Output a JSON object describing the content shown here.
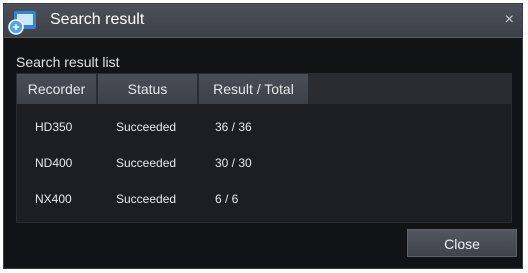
{
  "dialog": {
    "title": "Search result",
    "close_glyph": "×",
    "icon": "app-icon"
  },
  "section": {
    "label": "Search result list"
  },
  "table": {
    "columns": [
      "Recorder",
      "Status",
      "Result / Total"
    ],
    "rows": [
      [
        "HD350",
        "Succeeded",
        "36 / 36"
      ],
      [
        "ND400",
        "Succeeded",
        "30 / 30"
      ],
      [
        "NX400",
        "Succeeded",
        "6 / 6"
      ]
    ]
  },
  "footer": {
    "close_label": "Close"
  }
}
